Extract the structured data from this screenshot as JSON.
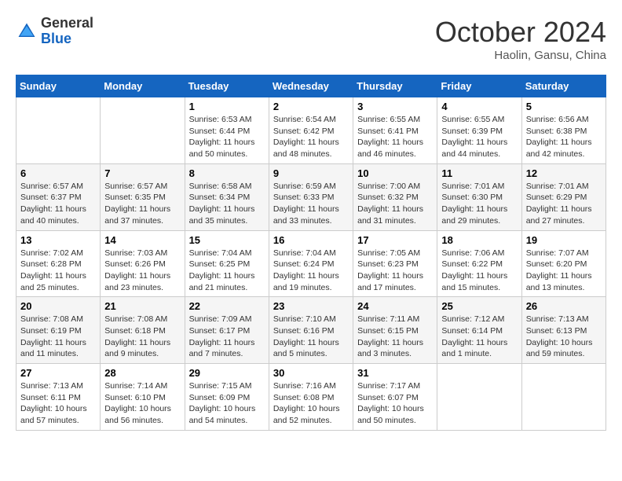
{
  "header": {
    "logo_general": "General",
    "logo_blue": "Blue",
    "title": "October 2024",
    "location": "Haolin, Gansu, China"
  },
  "weekdays": [
    "Sunday",
    "Monday",
    "Tuesday",
    "Wednesday",
    "Thursday",
    "Friday",
    "Saturday"
  ],
  "weeks": [
    [
      null,
      null,
      {
        "day": 1,
        "sunrise": "6:53 AM",
        "sunset": "6:44 PM",
        "daylight": "11 hours and 50 minutes."
      },
      {
        "day": 2,
        "sunrise": "6:54 AM",
        "sunset": "6:42 PM",
        "daylight": "11 hours and 48 minutes."
      },
      {
        "day": 3,
        "sunrise": "6:55 AM",
        "sunset": "6:41 PM",
        "daylight": "11 hours and 46 minutes."
      },
      {
        "day": 4,
        "sunrise": "6:55 AM",
        "sunset": "6:39 PM",
        "daylight": "11 hours and 44 minutes."
      },
      {
        "day": 5,
        "sunrise": "6:56 AM",
        "sunset": "6:38 PM",
        "daylight": "11 hours and 42 minutes."
      }
    ],
    [
      {
        "day": 6,
        "sunrise": "6:57 AM",
        "sunset": "6:37 PM",
        "daylight": "11 hours and 40 minutes."
      },
      {
        "day": 7,
        "sunrise": "6:57 AM",
        "sunset": "6:35 PM",
        "daylight": "11 hours and 37 minutes."
      },
      {
        "day": 8,
        "sunrise": "6:58 AM",
        "sunset": "6:34 PM",
        "daylight": "11 hours and 35 minutes."
      },
      {
        "day": 9,
        "sunrise": "6:59 AM",
        "sunset": "6:33 PM",
        "daylight": "11 hours and 33 minutes."
      },
      {
        "day": 10,
        "sunrise": "7:00 AM",
        "sunset": "6:32 PM",
        "daylight": "11 hours and 31 minutes."
      },
      {
        "day": 11,
        "sunrise": "7:01 AM",
        "sunset": "6:30 PM",
        "daylight": "11 hours and 29 minutes."
      },
      {
        "day": 12,
        "sunrise": "7:01 AM",
        "sunset": "6:29 PM",
        "daylight": "11 hours and 27 minutes."
      }
    ],
    [
      {
        "day": 13,
        "sunrise": "7:02 AM",
        "sunset": "6:28 PM",
        "daylight": "11 hours and 25 minutes."
      },
      {
        "day": 14,
        "sunrise": "7:03 AM",
        "sunset": "6:26 PM",
        "daylight": "11 hours and 23 minutes."
      },
      {
        "day": 15,
        "sunrise": "7:04 AM",
        "sunset": "6:25 PM",
        "daylight": "11 hours and 21 minutes."
      },
      {
        "day": 16,
        "sunrise": "7:04 AM",
        "sunset": "6:24 PM",
        "daylight": "11 hours and 19 minutes."
      },
      {
        "day": 17,
        "sunrise": "7:05 AM",
        "sunset": "6:23 PM",
        "daylight": "11 hours and 17 minutes."
      },
      {
        "day": 18,
        "sunrise": "7:06 AM",
        "sunset": "6:22 PM",
        "daylight": "11 hours and 15 minutes."
      },
      {
        "day": 19,
        "sunrise": "7:07 AM",
        "sunset": "6:20 PM",
        "daylight": "11 hours and 13 minutes."
      }
    ],
    [
      {
        "day": 20,
        "sunrise": "7:08 AM",
        "sunset": "6:19 PM",
        "daylight": "11 hours and 11 minutes."
      },
      {
        "day": 21,
        "sunrise": "7:08 AM",
        "sunset": "6:18 PM",
        "daylight": "11 hours and 9 minutes."
      },
      {
        "day": 22,
        "sunrise": "7:09 AM",
        "sunset": "6:17 PM",
        "daylight": "11 hours and 7 minutes."
      },
      {
        "day": 23,
        "sunrise": "7:10 AM",
        "sunset": "6:16 PM",
        "daylight": "11 hours and 5 minutes."
      },
      {
        "day": 24,
        "sunrise": "7:11 AM",
        "sunset": "6:15 PM",
        "daylight": "11 hours and 3 minutes."
      },
      {
        "day": 25,
        "sunrise": "7:12 AM",
        "sunset": "6:14 PM",
        "daylight": "11 hours and 1 minute."
      },
      {
        "day": 26,
        "sunrise": "7:13 AM",
        "sunset": "6:13 PM",
        "daylight": "10 hours and 59 minutes."
      }
    ],
    [
      {
        "day": 27,
        "sunrise": "7:13 AM",
        "sunset": "6:11 PM",
        "daylight": "10 hours and 57 minutes."
      },
      {
        "day": 28,
        "sunrise": "7:14 AM",
        "sunset": "6:10 PM",
        "daylight": "10 hours and 56 minutes."
      },
      {
        "day": 29,
        "sunrise": "7:15 AM",
        "sunset": "6:09 PM",
        "daylight": "10 hours and 54 minutes."
      },
      {
        "day": 30,
        "sunrise": "7:16 AM",
        "sunset": "6:08 PM",
        "daylight": "10 hours and 52 minutes."
      },
      {
        "day": 31,
        "sunrise": "7:17 AM",
        "sunset": "6:07 PM",
        "daylight": "10 hours and 50 minutes."
      },
      null,
      null
    ]
  ]
}
